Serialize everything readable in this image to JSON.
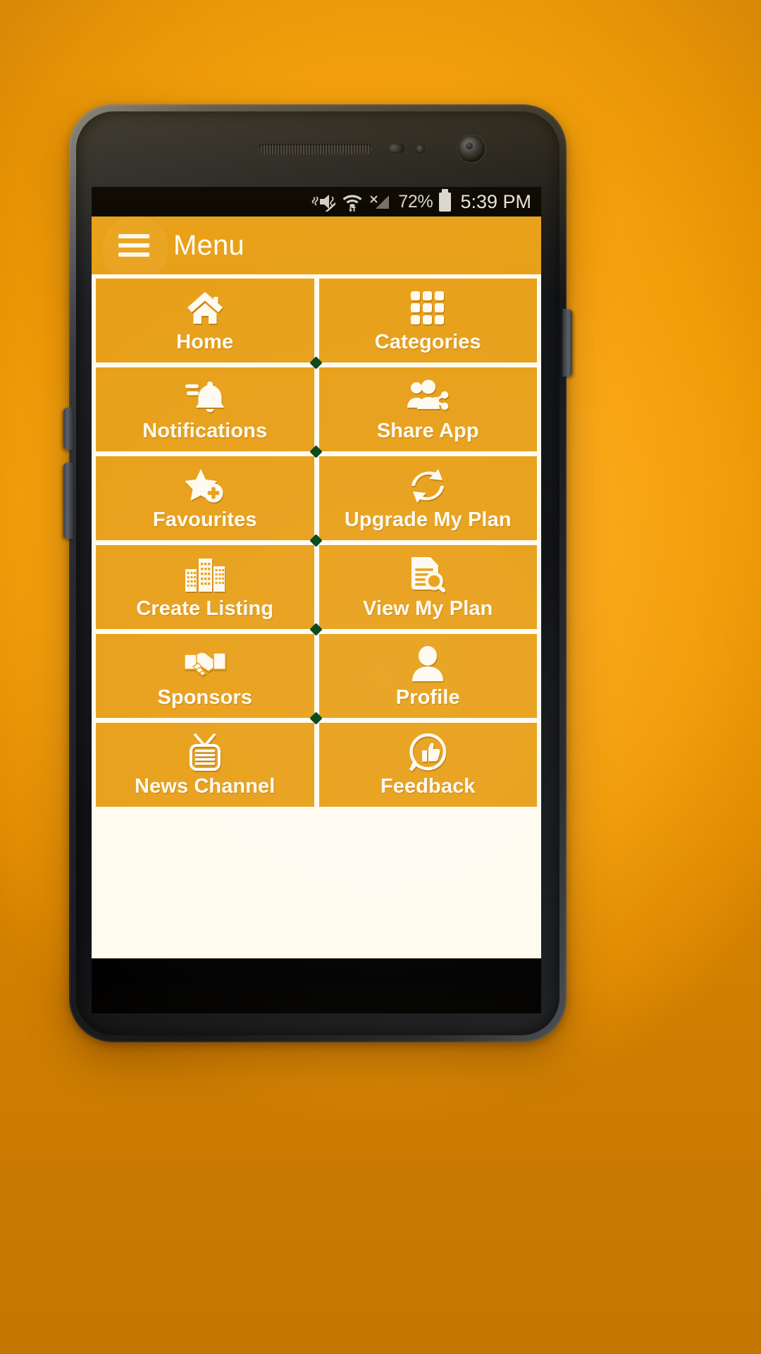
{
  "device": {
    "type": "android-smartphone",
    "frame_color": "#1b1e22",
    "backdrop_color": "#FBA714"
  },
  "status_bar": {
    "background": "#000000",
    "icons": [
      {
        "name": "vibrate-mute-icon",
        "label": "Vibrate / silent"
      },
      {
        "name": "wifi-icon",
        "label": "Wi-Fi connected with data transfer"
      },
      {
        "name": "no-signal-icon",
        "label": "No mobile signal"
      }
    ],
    "battery_percent": "72%",
    "battery_icon": "battery-icon",
    "time": "5:39 PM"
  },
  "app_bar": {
    "background": "#E8A01A",
    "menu_icon": "hamburger-menu-icon",
    "title": "Menu"
  },
  "menu_grid": {
    "tile_background": "#E8A01A",
    "tile_border": "#FFFBEF",
    "label_color": "#FFFAEF",
    "intersection_marker_color": "#0D4A1E",
    "columns": 2,
    "tiles": [
      {
        "label": "Home",
        "icon": "home-icon"
      },
      {
        "label": "Categories",
        "icon": "grid-apps-icon"
      },
      {
        "label": "Notifications",
        "icon": "bell-icon"
      },
      {
        "label": "Share App",
        "icon": "share-people-icon"
      },
      {
        "label": "Favourites",
        "icon": "star-plus-icon"
      },
      {
        "label": "Upgrade My Plan",
        "icon": "refresh-arrows-icon"
      },
      {
        "label": "Create Listing",
        "icon": "buildings-icon"
      },
      {
        "label": "View My Plan",
        "icon": "document-search-icon"
      },
      {
        "label": "Sponsors",
        "icon": "handshake-icon"
      },
      {
        "label": "Profile",
        "icon": "person-icon"
      },
      {
        "label": "News Channel",
        "icon": "television-icon"
      },
      {
        "label": "Feedback",
        "icon": "thumbs-up-bubble-icon"
      }
    ]
  }
}
